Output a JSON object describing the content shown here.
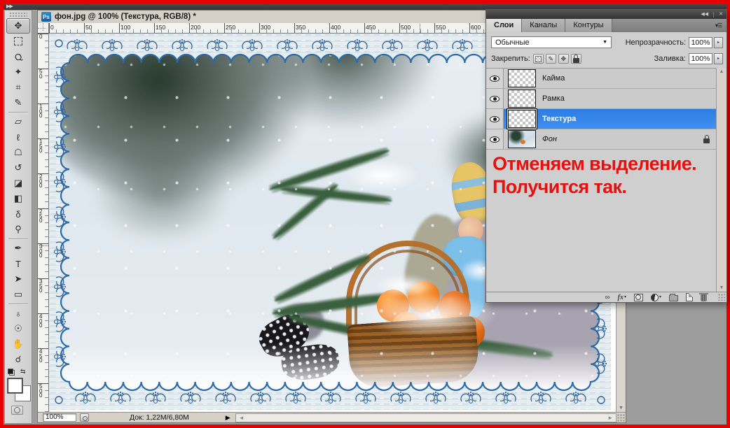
{
  "window": {
    "ps_badge": "Ps",
    "title": "фон.jpg @ 100% (Текстура, RGB/8) *"
  },
  "icons": {
    "collapse_left": "▶▶",
    "panel_collapse": "◀◀",
    "panel_close": "✕",
    "tab_menu": "▾☰",
    "dropdown": "▼",
    "spinner": "▸",
    "scroll_up": "▲",
    "scroll_down": "▼",
    "scroll_left": "◄",
    "scroll_right": "►",
    "status_popup": "▶",
    "swap_colors": "⇆",
    "link": "∞",
    "fx": "fx",
    "caret": "▾"
  },
  "toolbar": {
    "tools": [
      {
        "name": "move-tool",
        "glyph": "✥",
        "selected": true
      },
      {
        "name": "rect-marquee-tool",
        "glyph": "",
        "box": true
      },
      {
        "name": "lasso-tool",
        "glyph": "Q",
        "rot": -35
      },
      {
        "name": "magic-wand-tool",
        "glyph": "✦"
      },
      {
        "name": "crop-tool",
        "glyph": "⌗"
      },
      {
        "name": "eyedropper-tool",
        "glyph": "✎",
        "divider_after": true
      },
      {
        "name": "healing-brush-tool",
        "glyph": "▱"
      },
      {
        "name": "brush-tool",
        "glyph": "ℓ"
      },
      {
        "name": "clone-stamp-tool",
        "glyph": "☖"
      },
      {
        "name": "history-brush-tool",
        "glyph": "↺"
      },
      {
        "name": "eraser-tool",
        "glyph": "◪"
      },
      {
        "name": "gradient-tool",
        "glyph": "◧"
      },
      {
        "name": "blur-tool",
        "glyph": "δ"
      },
      {
        "name": "dodge-tool",
        "glyph": "⚲",
        "divider_after": true
      },
      {
        "name": "pen-tool",
        "glyph": "✒"
      },
      {
        "name": "type-tool",
        "glyph": "T"
      },
      {
        "name": "path-selection-tool",
        "glyph": "➤"
      },
      {
        "name": "shape-tool",
        "glyph": "▭",
        "divider_after": true
      },
      {
        "name": "rotate-3d-tool",
        "glyph": "♁"
      },
      {
        "name": "orbit-3d-tool",
        "glyph": "☉"
      },
      {
        "name": "hand-tool",
        "glyph": "✋"
      },
      {
        "name": "zoom-tool",
        "glyph": "☌"
      }
    ]
  },
  "rulers": {
    "horizontal": [
      "0",
      "50",
      "100",
      "150",
      "200",
      "250",
      "300",
      "350",
      "400",
      "450",
      "500",
      "550",
      "600"
    ],
    "vertical": [
      "0",
      "50",
      "100",
      "150",
      "200",
      "250",
      "300",
      "350",
      "400",
      "450",
      "500"
    ]
  },
  "status": {
    "zoom": "100%",
    "doc": "Док: 1,22М/6,80М"
  },
  "layers_panel": {
    "tabs": [
      {
        "label": "Слои",
        "active": true
      },
      {
        "label": "Каналы",
        "active": false
      },
      {
        "label": "Контуры",
        "active": false
      }
    ],
    "blend_mode": "Обычные",
    "opacity_label": "Непрозрачность:",
    "opacity_value": "100%",
    "lock_label": "Закрепить:",
    "fill_label": "Заливка:",
    "fill_value": "100%",
    "layers": [
      {
        "name": "Кайма",
        "visible": true,
        "thumb": "checker",
        "selected": false
      },
      {
        "name": "Рамка",
        "visible": true,
        "thumb": "checker",
        "selected": false
      },
      {
        "name": "Текстура",
        "visible": true,
        "thumb": "checker",
        "selected": true
      },
      {
        "name": "Фон",
        "visible": true,
        "thumb": "photo",
        "selected": false,
        "locked": true,
        "italic": true
      }
    ],
    "annotation": {
      "line1": "Отменяем выделение.",
      "line2": "Получится так."
    }
  },
  "colors": {
    "selection_blue": "#2f84ea",
    "annotation_red": "#e8100e",
    "ps_badge_blue": "#1d75bb",
    "screenshot_border_red": "#e80000",
    "frame_ornament_blue": "#31639c"
  }
}
